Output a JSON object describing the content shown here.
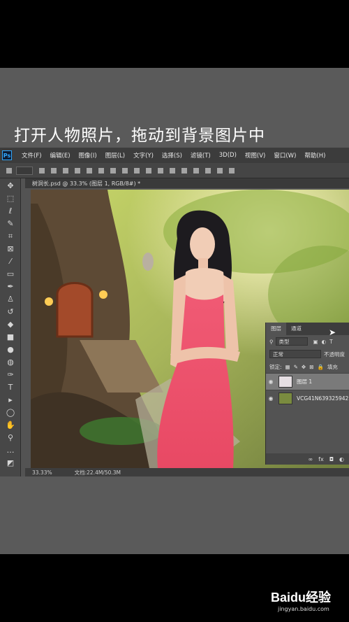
{
  "caption": "打开人物照片，拖动到背景图片中",
  "app": {
    "logo": "Ps",
    "menu": [
      "文件(F)",
      "编辑(E)",
      "图像(I)",
      "图层(L)",
      "文字(Y)",
      "选择(S)",
      "滤镜(T)",
      "3D(D)",
      "视图(V)",
      "窗口(W)",
      "帮助(H)"
    ],
    "document_tab": "树洞长.psd @ 33.3% (图层 1, RGB/8#) *",
    "status": {
      "zoom": "33.33%",
      "file_size": "文档:22.4M/50.3M"
    }
  },
  "layers_panel": {
    "tabs": [
      "图层",
      "通道"
    ],
    "filter": "类型",
    "blend_mode": "正常",
    "opacity_label": "不透明度",
    "lock_label": "锁定:",
    "fill_label": "填充",
    "layers": [
      {
        "name": "图层 1",
        "selected": true
      },
      {
        "name": "VCG41N639325942",
        "selected": false
      }
    ],
    "bottom_icons": [
      "link-icon",
      "fx-icon",
      "mask-icon",
      "adjustment-icon"
    ]
  },
  "watermark": {
    "brand": "Baidu经验",
    "url": "jingyan.baidu.com"
  },
  "colors": {
    "ps_blue": "#31a8ff",
    "dress": "#e8506a",
    "panel": "#535353"
  }
}
